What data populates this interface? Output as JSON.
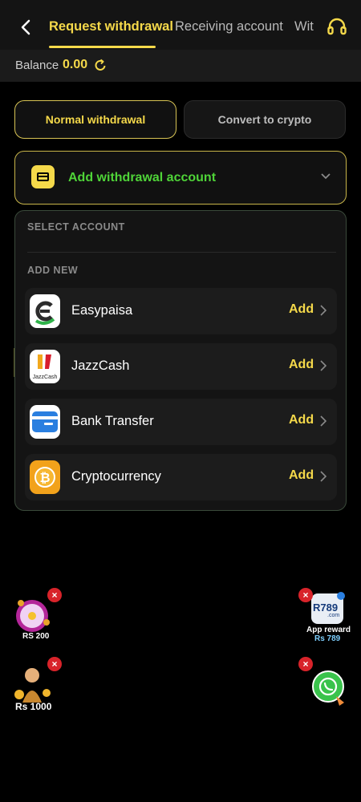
{
  "header": {
    "tabs": [
      {
        "label": "Request withdrawal",
        "active": true
      },
      {
        "label": "Receiving account",
        "active": false
      },
      {
        "label": "Wit",
        "active": false
      }
    ],
    "back_icon": "chevron-left-icon",
    "support_icon": "headset-icon"
  },
  "balance": {
    "label": "Balance",
    "value": "0.00",
    "refresh_icon": "refresh-icon"
  },
  "modes": {
    "normal_label": "Normal withdrawal",
    "crypto_label": "Convert to crypto"
  },
  "add_account": {
    "label": "Add withdrawal account",
    "icon": "card-icon"
  },
  "panel": {
    "select_label": "SELECT ACCOUNT",
    "add_new_label": "ADD NEW",
    "methods": [
      {
        "name": "Easypaisa",
        "action": "Add",
        "icon": "easypaisa-icon"
      },
      {
        "name": "JazzCash",
        "action": "Add",
        "icon": "jazzcash-icon"
      },
      {
        "name": "Bank Transfer",
        "action": "Add",
        "icon": "bank-card-icon"
      },
      {
        "name": "Cryptocurrency",
        "action": "Add",
        "icon": "bitcoin-icon"
      }
    ]
  },
  "floats": {
    "wheel_promo": "RS 200",
    "bonus_promo": "Rs 1000",
    "app_reward_label": "App reward",
    "app_reward_value": "Rs 789",
    "app_logo": "R789",
    "app_logo_sub": ".com",
    "close_symbol": "×"
  },
  "colors": {
    "accent": "#f5d94a",
    "success": "#4fd438",
    "background": "#000000",
    "close": "#d8232a"
  }
}
